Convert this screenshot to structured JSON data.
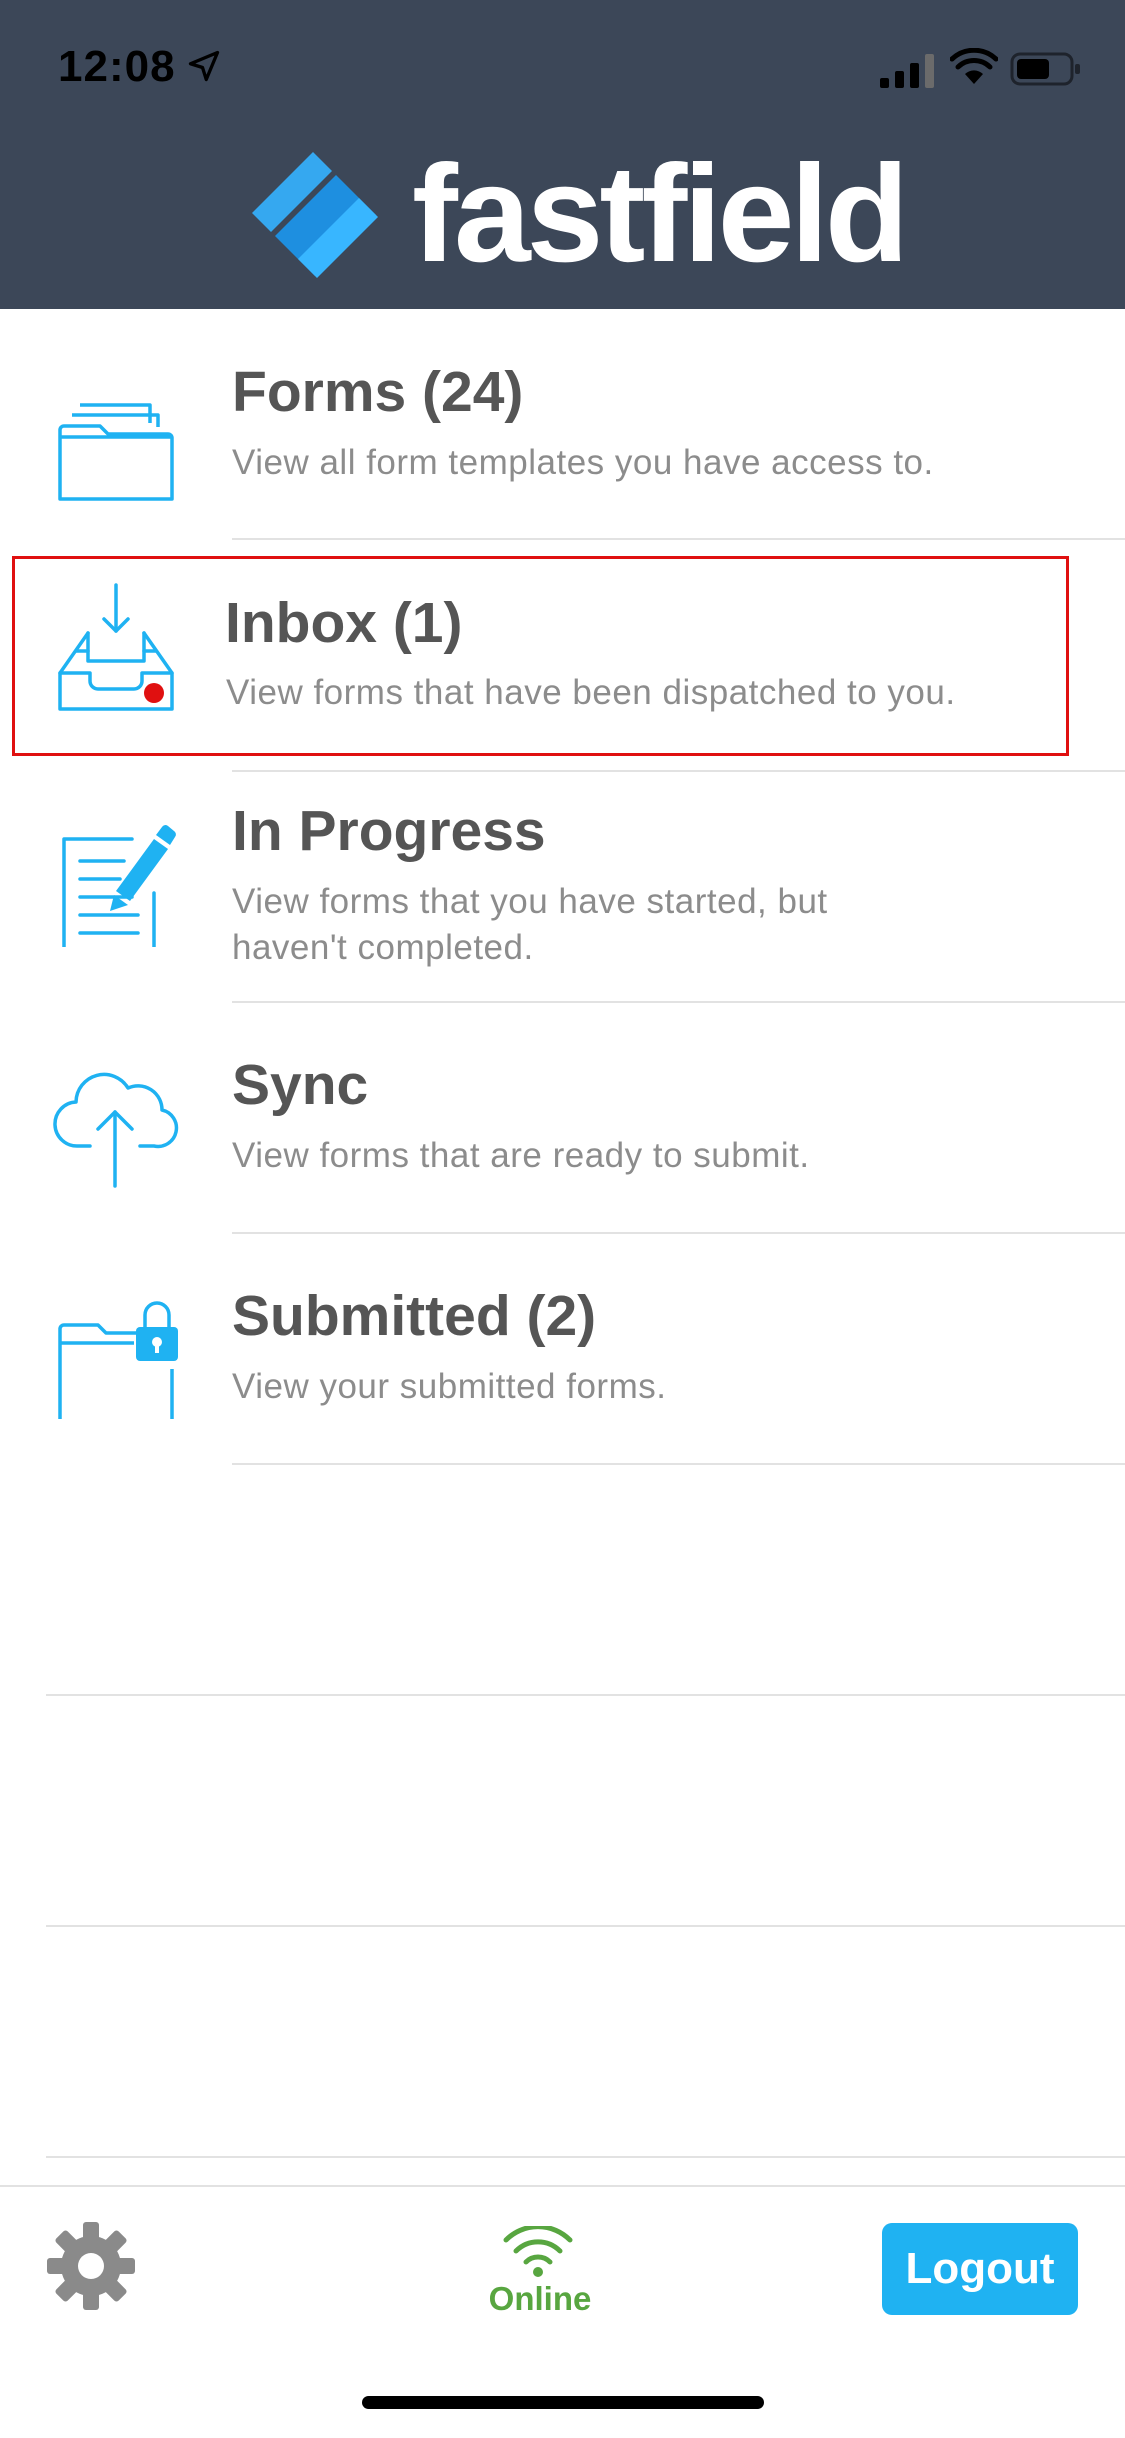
{
  "status_bar": {
    "time": "12:08"
  },
  "header": {
    "brand": "fastfield"
  },
  "menu": [
    {
      "title": "Forms (24)",
      "description": "View all form templates you have access to."
    },
    {
      "title": "Inbox (1)",
      "description": "View forms that have been dispatched to you."
    },
    {
      "title": "In Progress",
      "description": "View forms that you have started, but haven't completed."
    },
    {
      "title": "Sync",
      "description": "View forms that are ready to submit."
    },
    {
      "title": "Submitted (2)",
      "description": "View your submitted forms."
    }
  ],
  "toolbar": {
    "status_label": "Online",
    "logout_label": "Logout"
  },
  "colors": {
    "header": "#3c4758",
    "accent": "#1fb2f2",
    "online": "#58a640",
    "highlight": "#e01010",
    "unread_dot": "#e01010"
  },
  "icons": [
    "location-arrow-icon",
    "cellular-signal-icon",
    "wifi-icon",
    "battery-icon",
    "fastfield-logo-mark",
    "forms-folder-icon",
    "inbox-tray-icon",
    "in-progress-document-icon",
    "sync-cloud-upload-icon",
    "submitted-locked-folder-icon",
    "gear-icon",
    "online-wifi-icon"
  ]
}
